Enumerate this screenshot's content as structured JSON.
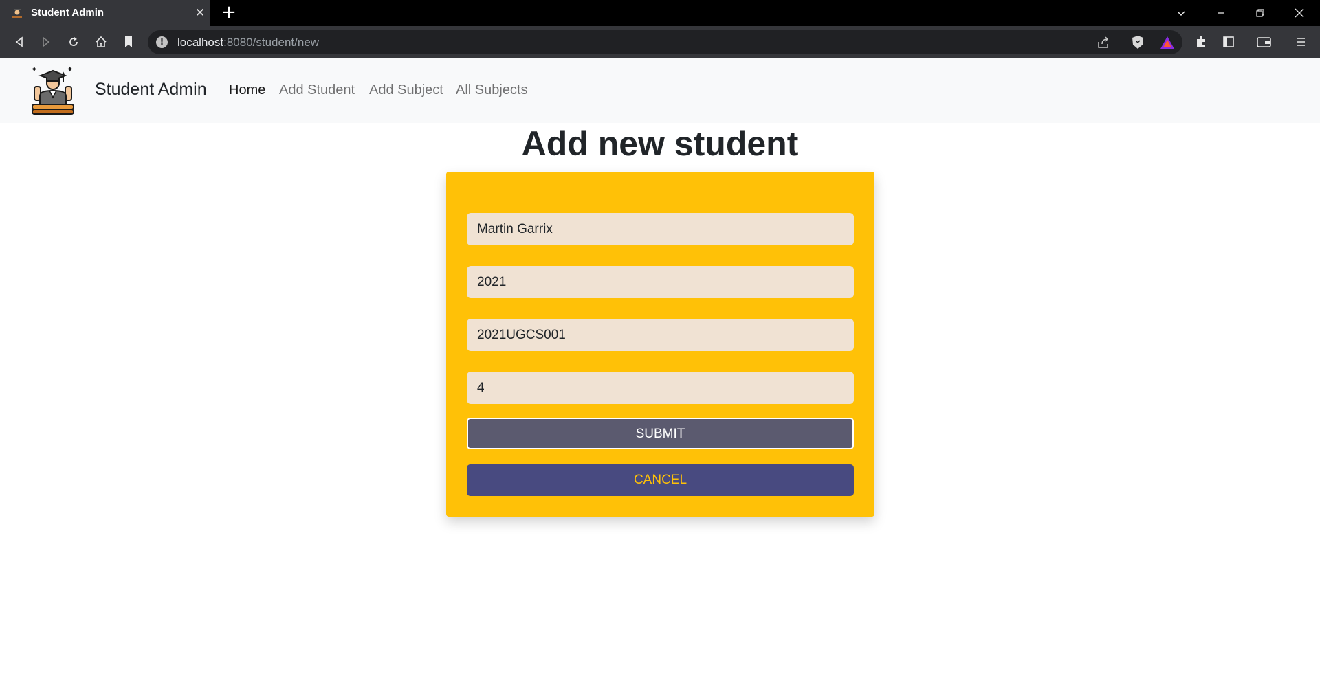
{
  "browser": {
    "tab_title": "Student Admin",
    "new_tab_icon": "plus-icon",
    "url_host": "localhost",
    "url_path": ":8080/student/new"
  },
  "navbar": {
    "brand": "Student Admin",
    "links": [
      "Home",
      "Add Student",
      "Add Subject",
      "All Subjects"
    ],
    "active": "Home"
  },
  "main": {
    "title": "Add new student",
    "fields": {
      "name": "Martin Garrix",
      "year": "2021",
      "roll_number": "2021UGCS001",
      "semester": "4"
    },
    "submit_label": "SUBMIT",
    "cancel_label": "CANCEL"
  },
  "colors": {
    "card": "#ffc107",
    "field": "#f0e2d3",
    "submit": "#5b5a6f",
    "cancel": "#484a80"
  }
}
